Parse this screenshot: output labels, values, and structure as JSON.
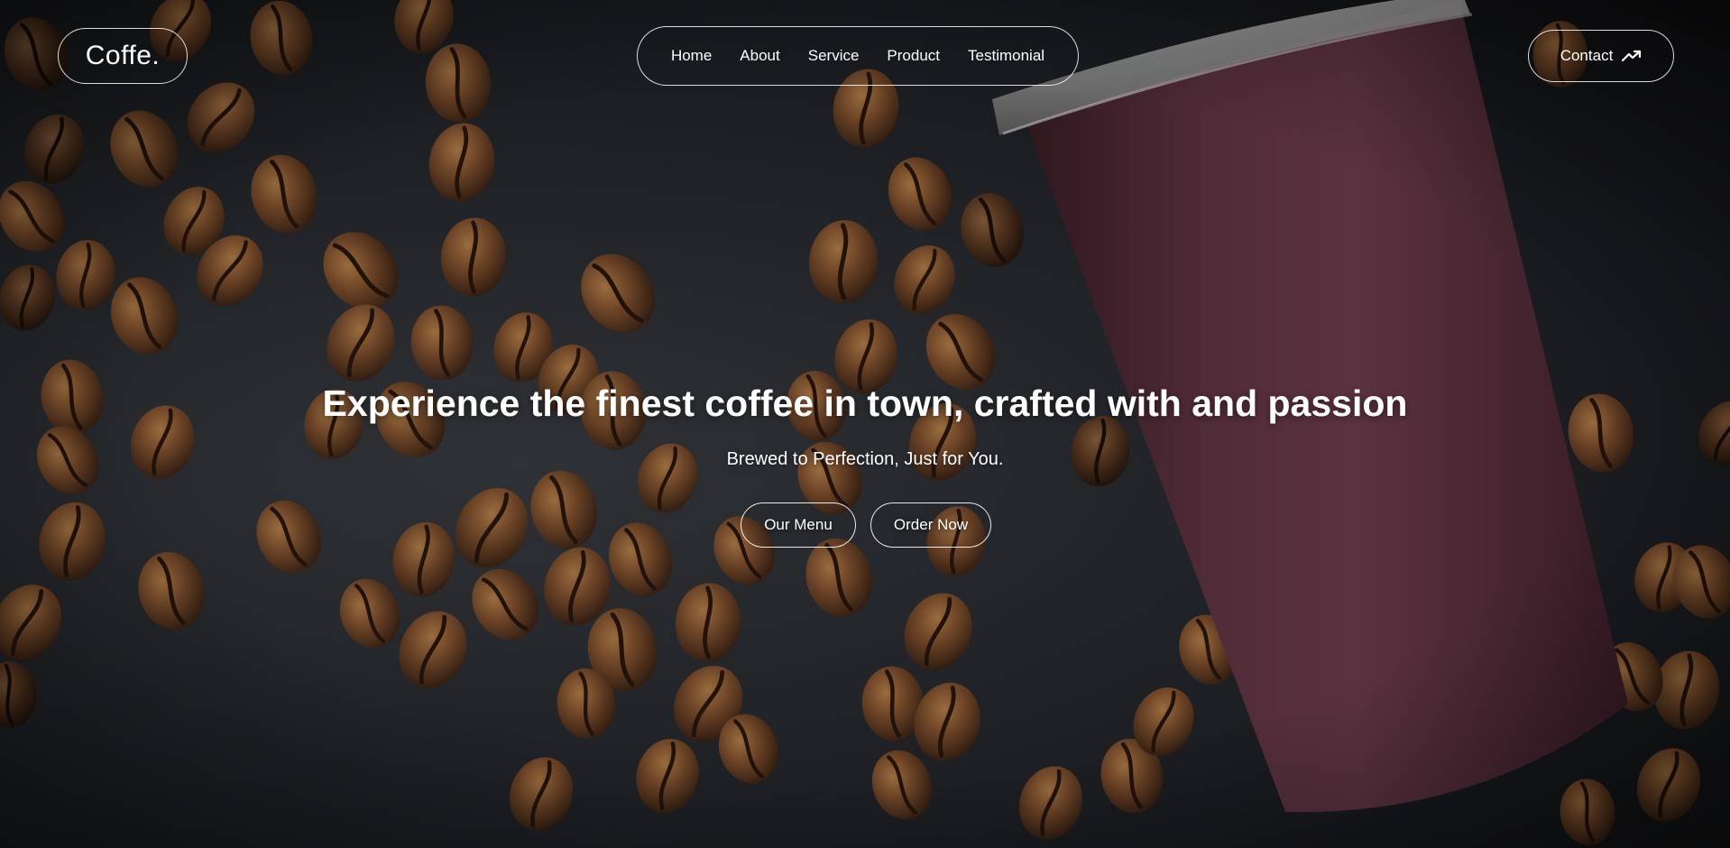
{
  "brand": {
    "logo_text": "Coffe."
  },
  "nav": {
    "items": [
      {
        "label": "Home"
      },
      {
        "label": "About"
      },
      {
        "label": "Service"
      },
      {
        "label": "Product"
      },
      {
        "label": "Testimonial"
      }
    ]
  },
  "contact": {
    "label": "Contact",
    "icon": "trending-up-icon"
  },
  "hero": {
    "headline": "Experience the finest coffee in town, crafted with and passion",
    "subtitle": "Brewed to Perfection, Just for You.",
    "buttons": {
      "menu_label": "Our Menu",
      "order_label": "Order Now"
    }
  },
  "colors": {
    "background": "#2b2e33",
    "cup": "#5e3443",
    "bean": "#7a4a26",
    "text": "#ffffff"
  }
}
